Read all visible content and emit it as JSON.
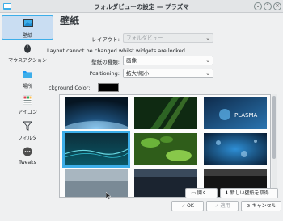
{
  "window": {
    "title": "フォルダビューの設定 — プラズマ"
  },
  "sidebar": {
    "items": [
      {
        "label": "壁紙",
        "icon": "wallpaper-icon"
      },
      {
        "label": "マウスアクション",
        "icon": "mouse-icon"
      },
      {
        "label": "場所",
        "icon": "folder-icon"
      },
      {
        "label": "アイコン",
        "icon": "icons-grid-icon"
      },
      {
        "label": "フィルタ",
        "icon": "filter-icon"
      },
      {
        "label": "Tweaks",
        "icon": "tweaks-icon"
      }
    ]
  },
  "main": {
    "title": "壁紙",
    "layout_label": "レイアウト:",
    "layout_value": "フォルダビュー",
    "locked_notice": "Layout cannot be changed whilst widgets are locked",
    "wallpaper_type_label": "壁紙の種類:",
    "wallpaper_type_value": "画像",
    "positioning_label": "Positioning:",
    "positioning_value": "拡大/縮小",
    "bgcolor_label": "ckground Color:",
    "bgcolor_value": "#000000",
    "open_button": "開く...",
    "new_wallpapers_button": "新しい壁紙を取得..."
  },
  "footer": {
    "ok": "OK",
    "apply": "適用",
    "cancel": "キャンセル"
  },
  "thumbnails": [
    {
      "name": "earth-orbit",
      "caption": ""
    },
    {
      "name": "green-rays",
      "caption": ""
    },
    {
      "name": "plasma-blue",
      "caption": "PLASMA"
    },
    {
      "name": "teal-wave",
      "caption": ""
    },
    {
      "name": "green-leaves",
      "caption": ""
    },
    {
      "name": "blue-bokeh",
      "caption": ""
    },
    {
      "name": "grey-mist",
      "caption": ""
    },
    {
      "name": "dark-sky",
      "caption": ""
    },
    {
      "name": "dark-abstract",
      "caption": ""
    }
  ],
  "colors": {
    "accent": "#3daee9",
    "selection_bg": "#c9ddf2",
    "window_bg": "#eff0f1"
  }
}
